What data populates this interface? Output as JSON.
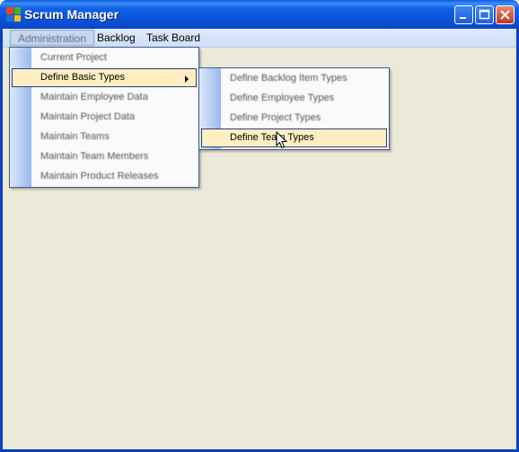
{
  "window": {
    "title": "Scrum Manager",
    "icon": "scrum-app-icon",
    "controls": {
      "minimize": "minimize-icon",
      "maximize": "maximize-icon",
      "close": "close-icon"
    }
  },
  "menubar": {
    "items": [
      {
        "label": "Administration"
      },
      {
        "label": "Backlog"
      },
      {
        "label": "Task Board"
      }
    ]
  },
  "admin_menu": {
    "items": [
      {
        "label": "Current Project"
      },
      {
        "label": "Define Basic Types"
      },
      {
        "label": "Maintain Employee Data"
      },
      {
        "label": "Maintain Project Data"
      },
      {
        "label": "Maintain Teams"
      },
      {
        "label": "Maintain Team Members"
      },
      {
        "label": "Maintain Product Releases"
      }
    ]
  },
  "basic_types_menu": {
    "items": [
      {
        "label": "Define Backlog Item Types"
      },
      {
        "label": "Define Employee Types"
      },
      {
        "label": "Define Project Types"
      },
      {
        "label": "Define Team Types"
      }
    ]
  },
  "colors": {
    "title_bar": "#0a52d8",
    "highlight": "#ffeec2",
    "background": "#ece9d8"
  }
}
